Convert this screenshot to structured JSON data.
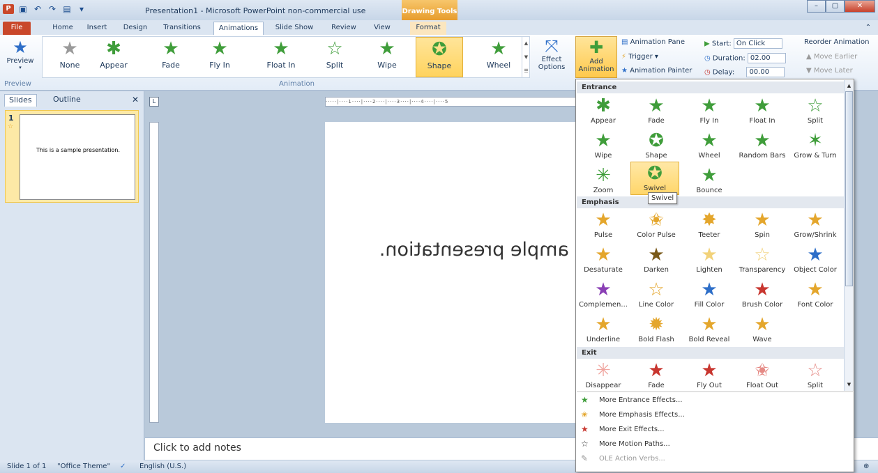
{
  "window": {
    "title": "Presentation1 - Microsoft PowerPoint non-commercial use",
    "context_tab_group": "Drawing Tools",
    "controls": [
      "–",
      "▢",
      "✕"
    ]
  },
  "tabs": [
    "File",
    "Home",
    "Insert",
    "Design",
    "Transitions",
    "Animations",
    "Slide Show",
    "Review",
    "View",
    "Format"
  ],
  "active_tab": "Animations",
  "ribbon": {
    "preview_label": "Preview",
    "preview_group": "Preview",
    "animation_group": "Animation",
    "gallery": [
      "None",
      "Appear",
      "Fade",
      "Fly In",
      "Float In",
      "Split",
      "Wipe",
      "Shape",
      "Wheel"
    ],
    "selected_gallery": "Shape",
    "effect_options_label": "Effect Options",
    "add_animation_label": "Add Animation",
    "animation_pane": "Animation Pane",
    "trigger": "Trigger",
    "animation_painter": "Animation Painter",
    "start_label": "Start:",
    "start_value": "On Click",
    "duration_label": "Duration:",
    "duration_value": "02.00",
    "delay_label": "Delay:",
    "delay_value": "00.00",
    "reorder_label": "Reorder Animation",
    "move_earlier": "Move Earlier",
    "move_later": "Move Later"
  },
  "slides_panel": {
    "tab_slides": "Slides",
    "tab_outline": "Outline",
    "slide_number": "1",
    "thumb_text": "This is a sample presentation."
  },
  "slide": {
    "text": "ample presentation."
  },
  "notes_placeholder": "Click to add notes",
  "status": {
    "slide": "Slide 1 of 1",
    "theme": "\"Office Theme\"",
    "language": "English (U.S.)"
  },
  "dropdown": {
    "entrance_header": "Entrance",
    "entrance": [
      "Appear",
      "Fade",
      "Fly In",
      "Float In",
      "Split",
      "Wipe",
      "Shape",
      "Wheel",
      "Random Bars",
      "Grow & Turn",
      "Zoom",
      "Swivel",
      "Bounce"
    ],
    "emphasis_header": "Emphasis",
    "emphasis": [
      "Pulse",
      "Color Pulse",
      "Teeter",
      "Spin",
      "Grow/Shrink",
      "Desaturate",
      "Darken",
      "Lighten",
      "Transparency",
      "Object Color",
      "Complemen...",
      "Line Color",
      "Fill Color",
      "Brush Color",
      "Font Color",
      "Underline",
      "Bold Flash",
      "Bold Reveal",
      "Wave"
    ],
    "exit_header": "Exit",
    "exit": [
      "Disappear",
      "Fade",
      "Fly Out",
      "Float Out",
      "Split"
    ],
    "more": [
      "More Entrance Effects...",
      "More Emphasis Effects...",
      "More Exit Effects...",
      "More Motion Paths...",
      "OLE Action Verbs..."
    ],
    "tooltip": "Swivel",
    "hovered": "Swivel"
  }
}
